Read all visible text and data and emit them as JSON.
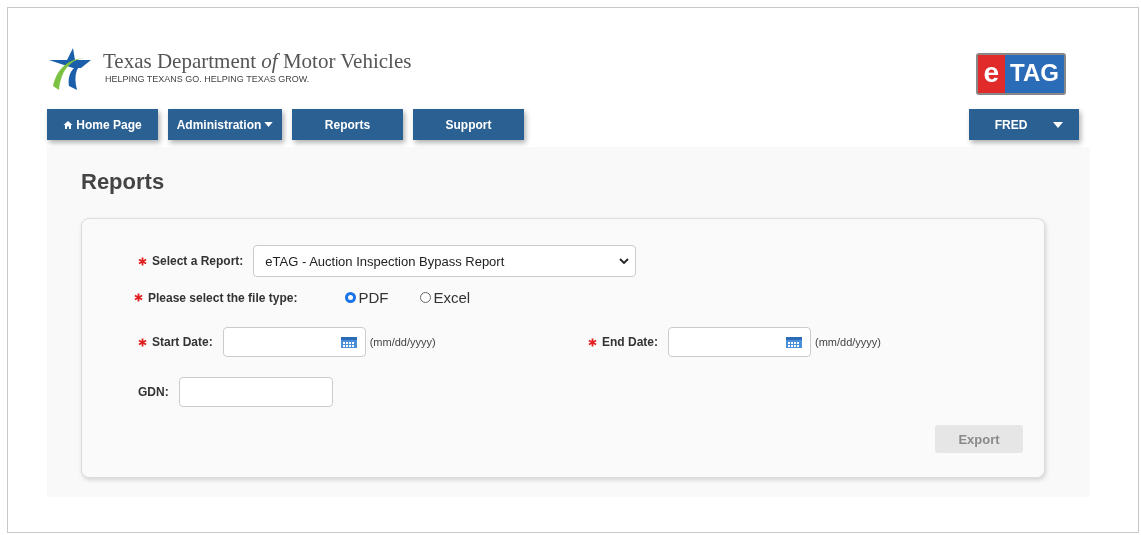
{
  "header": {
    "agency": "Texas Department *of* Motor Vehicles",
    "tagline": "HELPING TEXANS GO. HELPING TEXAS GROW.",
    "logo": {
      "e": "e",
      "tag": "TAG"
    }
  },
  "nav": [
    {
      "label": "Home Page",
      "kind": "home"
    },
    {
      "label": "Administration",
      "kind": "dropdown"
    },
    {
      "label": "Reports",
      "kind": "plain"
    },
    {
      "label": "Support",
      "kind": "plain"
    }
  ],
  "user_menu": {
    "label": "FRED"
  },
  "page_title": "Reports",
  "form": {
    "report": {
      "label": "Select a Report:",
      "required": true,
      "value": "eTAG - Auction Inspection Bypass Report"
    },
    "file_type": {
      "label": "Please select the file type:",
      "required": true,
      "options": [
        {
          "label": "PDF",
          "selected": true
        },
        {
          "label": "Excel",
          "selected": false
        }
      ]
    },
    "start_date": {
      "label": "Start Date:",
      "required": true,
      "hint": "(mm/dd/yyyy)"
    },
    "end_date": {
      "label": "End Date:",
      "required": true,
      "hint": "(mm/dd/yyyy)"
    },
    "gdn": {
      "label": "GDN:",
      "required": false
    },
    "export": {
      "label": "Export",
      "disabled": true
    }
  }
}
